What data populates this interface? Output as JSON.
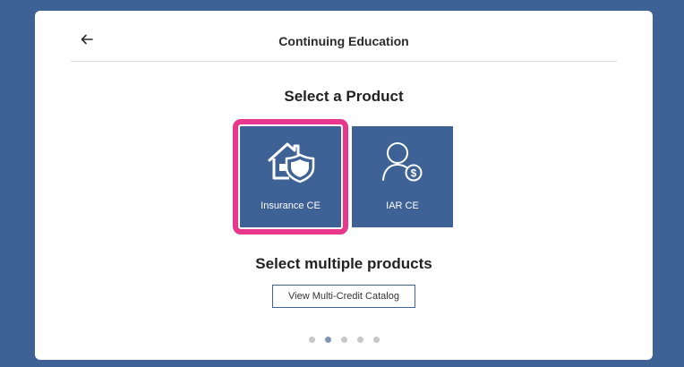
{
  "header": {
    "title": "Continuing Education"
  },
  "main": {
    "select_product_heading": "Select a Product",
    "products": [
      {
        "label": "Insurance CE",
        "icon": "house-shield-icon",
        "selected": true
      },
      {
        "label": "IAR CE",
        "icon": "person-dollar-icon",
        "selected": false
      }
    ],
    "select_multiple_heading": "Select multiple products",
    "catalog_button_label": "View Multi-Credit Catalog"
  },
  "pagination": {
    "count": 5,
    "active_index": 1
  },
  "colors": {
    "background": "#3e6295",
    "tile": "#3e6295",
    "highlight": "#e8378d"
  }
}
